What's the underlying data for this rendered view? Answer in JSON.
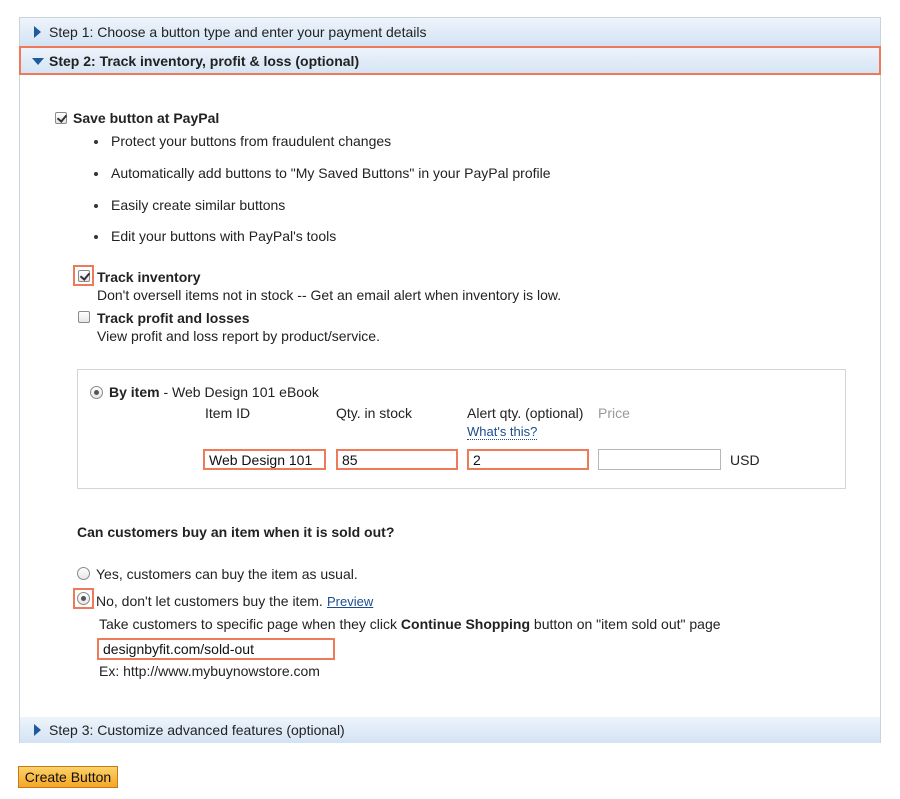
{
  "steps": {
    "step1_label": "Step 1: Choose a button type and enter your payment details",
    "step2_label": "Step 2: Track inventory, profit & loss (optional)",
    "step3_label": "Step 3: Customize advanced features (optional)"
  },
  "save_button": {
    "label": "Save button at PayPal",
    "checked": true,
    "bullets": [
      "Protect your buttons from fraudulent changes",
      "Automatically add buttons to \"My Saved Buttons\" in your PayPal profile",
      "Easily create similar buttons",
      "Edit your buttons with PayPal's tools"
    ]
  },
  "track_inventory": {
    "label": "Track inventory",
    "description": "Don't oversell items not in stock -- Get an email alert when inventory is low.",
    "checked": true
  },
  "track_profit": {
    "label": "Track profit and losses",
    "description": "View profit and loss report by product/service.",
    "checked": false
  },
  "by_item": {
    "label": "By item",
    "separator": "-",
    "item_name": "Web Design 101 eBook",
    "col_item_id": "Item ID",
    "col_qty": "Qty. in stock",
    "col_alert": "Alert qty. (optional)",
    "col_price": "Price",
    "whats_this": "What's this?",
    "item_id_value": "Web Design 101",
    "qty_value": "85",
    "alert_value": "2",
    "price_value": "",
    "currency": "USD"
  },
  "sold_out": {
    "question": "Can customers buy an item when it is sold out?",
    "option_yes": "Yes, customers can buy the item as usual.",
    "option_no": "No, don't let customers buy the item.",
    "preview_link": "Preview",
    "instruction_prefix": "Take customers to specific page when they click",
    "instruction_bold": "Continue Shopping",
    "instruction_suffix": "button on \"item sold out\" page",
    "url_value": "designbyfit.com/sold-out",
    "example": "Ex: http://www.mybuynowstore.com"
  },
  "create_button_label": "Create Button",
  "colors": {
    "highlight": "#ef7a5a",
    "header_blue": "#d3e3f4",
    "link": "#1a4d8f",
    "button_orange": "#f5a623"
  }
}
